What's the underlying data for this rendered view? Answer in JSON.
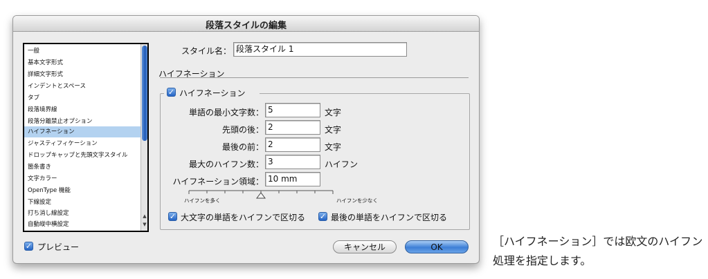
{
  "dialog": {
    "title": "段落スタイルの編集"
  },
  "sidebar": {
    "items": [
      {
        "label": "一般"
      },
      {
        "label": "基本文字形式"
      },
      {
        "label": "詳細文字形式"
      },
      {
        "label": "インデントとスペース"
      },
      {
        "label": "タブ"
      },
      {
        "label": "段落境界線"
      },
      {
        "label": "段落分離禁止オプション"
      },
      {
        "label": "ハイフネーション"
      },
      {
        "label": "ジャスティフィケーション"
      },
      {
        "label": "ドロップキャップと先頭文字スタイル"
      },
      {
        "label": "箇条書き"
      },
      {
        "label": "文字カラー"
      },
      {
        "label": "OpenType 機能"
      },
      {
        "label": "下線設定"
      },
      {
        "label": "打ち消し線設定"
      },
      {
        "label": "自動縦中横設定"
      }
    ],
    "selected": "ハイフネーション"
  },
  "style_name": {
    "label": "スタイル名：",
    "value": "段落スタイル 1"
  },
  "section": {
    "heading": "ハイフネーション"
  },
  "hyphenation": {
    "checkbox_label": "ハイフネーション",
    "checked": true,
    "fields": {
      "min_chars": {
        "label": "単語の最小文字数：",
        "value": "5",
        "unit": "文字"
      },
      "after_first": {
        "label": "先頭の後：",
        "value": "2",
        "unit": "文字"
      },
      "before_last": {
        "label": "最後の前：",
        "value": "2",
        "unit": "文字"
      },
      "hyphen_limit": {
        "label": "最大のハイフン数：",
        "value": "3",
        "unit": "ハイフン"
      },
      "zone": {
        "label": "ハイフネーション領域：",
        "value": "10 mm"
      }
    },
    "slider": {
      "left_label": "ハイフンを多く",
      "right_label": "ハイフンを少なく",
      "level": 0.5
    },
    "capitalized": {
      "label": "大文字の単語をハイフンで区切る",
      "checked": true
    },
    "last_word": {
      "label": "最後の単語をハイフンで区切る",
      "checked": true
    }
  },
  "preview": {
    "label": "プレビュー",
    "checked": true
  },
  "buttons": {
    "cancel": "キャンセル",
    "ok": "OK"
  },
  "caption": {
    "text": "［ハイフネーション］では欧文のハイフン処理を指定します。"
  },
  "colors": {
    "accent": "#2463c4",
    "selection": "#b3d2f0"
  }
}
